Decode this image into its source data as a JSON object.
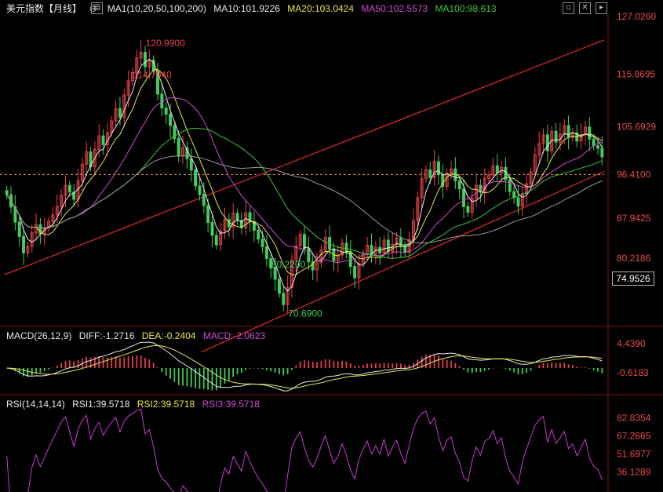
{
  "header": {
    "title": "美元指数【月线】",
    "ma_label": "MA1(10,20,50,100,200)",
    "ma10": "MA10:101.9226",
    "ma20": "MA20:103.0424",
    "ma50": "MA50:102.5573",
    "ma100": "MA100:98.613"
  },
  "macd_header": {
    "label": "MACD(26,12,9)",
    "diff": "DIFF:-1.2716",
    "dea": "DEA:-0.2404",
    "macd": "MACD:-2.0623"
  },
  "rsi_header": {
    "label": "RSI(14,14,14)",
    "rsi1": "RSI1:39.5718",
    "rsi2": "RSI2:39.5718",
    "rsi3": "RSI3:39.5718"
  },
  "last_price": "74.9526",
  "colors": {
    "up": "#e8404a",
    "down": "#3fcf5a",
    "ma10": "#e8e8e8",
    "ma20": "#e6e64a",
    "ma50": "#d24ad2",
    "ma100": "#3cc83c",
    "ma200": "#9a9a9a",
    "channel": "#e52a2a",
    "axis_text": "#e84b4b",
    "rsi": "#c83cd2",
    "dashed": "#e0a040"
  },
  "chart_data": {
    "type": "candlestick",
    "price_axis": {
      "ylim": [
        70.0,
        127.5
      ],
      "ticks": [
        "127.0260",
        "115.8695",
        "105.6929",
        "96.4100",
        "87.9425",
        "80.2186"
      ]
    },
    "annotations": [
      {
        "label": "120.9900",
        "value": 120.99,
        "kind": "high"
      },
      {
        "label": "80.2200",
        "value": 80.22,
        "kind": "low"
      },
      {
        "label": "70.6900",
        "value": 70.69,
        "kind": "low"
      },
      {
        "label": "114.7940",
        "value": 114.794,
        "kind": "high"
      }
    ],
    "reference_line": 96.41,
    "channel_lines": [
      {
        "from": [
          0,
          77.0
        ],
        "to": [
          320,
          122.5
        ]
      },
      {
        "from": [
          105,
          62.0
        ],
        "to": [
          320,
          97.0
        ]
      }
    ],
    "closes": [
      92.5,
      90.1,
      87.2,
      84.4,
      81.2,
      82.5,
      85.1,
      86.7,
      84.9,
      86.0,
      87.3,
      88.6,
      90.2,
      92.4,
      94.3,
      93.0,
      91.6,
      95.2,
      98.4,
      100.8,
      97.9,
      101.3,
      103.9,
      102.2,
      104.5,
      106.8,
      109.2,
      107.5,
      111.8,
      114.6,
      116.2,
      119.0,
      120.1,
      117.3,
      118.6,
      116.4,
      112.0,
      109.3,
      108.1,
      105.9,
      103.4,
      100.1,
      101.6,
      99.5,
      97.3,
      94.2,
      92.6,
      90.4,
      87.1,
      84.6,
      82.8,
      85.5,
      87.7,
      86.3,
      88.9,
      87.5,
      86.1,
      89.0,
      87.3,
      85.6,
      83.9,
      82.4,
      80.1,
      78.3,
      76.1,
      73.4,
      71.2,
      74.5,
      79.8,
      82.6,
      84.8,
      82.1,
      79.5,
      77.9,
      79.3,
      81.8,
      84.2,
      82.0,
      79.7,
      80.8,
      83.1,
      81.4,
      78.6,
      76.4,
      79.2,
      81.0,
      82.7,
      80.9,
      82.3,
      81.2,
      83.7,
      81.5,
      82.9,
      84.1,
      82.6,
      81.3,
      83.8,
      87.5,
      91.9,
      95.6,
      97.3,
      95.8,
      98.9,
      96.4,
      94.1,
      96.7,
      97.5,
      95.2,
      93.6,
      90.2,
      89.1,
      91.8,
      94.3,
      93.0,
      95.6,
      96.3,
      98.1,
      96.7,
      97.8,
      95.4,
      93.1,
      91.9,
      90.3,
      92.7,
      94.6,
      96.9,
      100.2,
      102.4,
      104.1,
      101.0,
      104.8,
      102.7,
      104.2,
      105.9,
      103.6,
      104.5,
      102.9,
      104.1,
      105.6,
      103.3,
      102.0,
      101.5,
      99.8
    ],
    "ma_series": [
      {
        "name": "MA10",
        "period": 10
      },
      {
        "name": "MA20",
        "period": 20
      },
      {
        "name": "MA50",
        "period": 50
      },
      {
        "name": "MA100",
        "period": 100
      },
      {
        "name": "MA200",
        "period": 200
      }
    ],
    "macd_axis": {
      "ticks": [
        "4.4390",
        "-0.6183"
      ]
    },
    "rsi_axis": {
      "ticks": [
        "82.8354",
        "67.2665",
        "51.6977",
        "36.1289"
      ]
    }
  }
}
